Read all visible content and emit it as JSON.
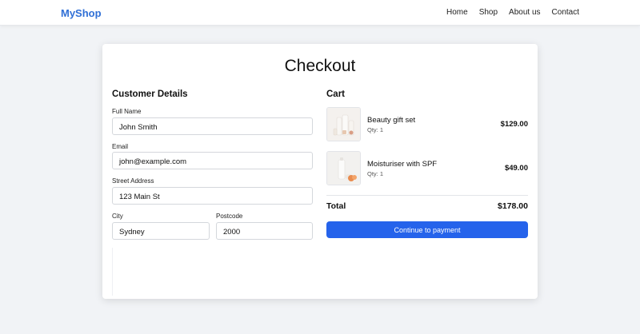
{
  "nav": {
    "brand": "MyShop",
    "links": [
      "Home",
      "Shop",
      "About us",
      "Contact"
    ],
    "brand_color": "#2f6fd6"
  },
  "checkout": {
    "title": "Checkout",
    "customer": {
      "heading": "Customer Details",
      "full_name_label": "Full Name",
      "full_name_value": "John Smith",
      "email_label": "Email",
      "email_value": "john@example.com",
      "street_label": "Street Address",
      "street_value": "123 Main St",
      "city_label": "City",
      "city_value": "Sydney",
      "postcode_label": "Postcode",
      "postcode_value": "2000"
    },
    "cart": {
      "heading": "Cart",
      "items": [
        {
          "name": "Beauty gift set",
          "qty": "Qty: 1",
          "price": "$129.00",
          "icon": "beauty-gift-set-thumbnail"
        },
        {
          "name": "Moisturiser with SPF",
          "qty": "Qty: 1",
          "price": "$49.00",
          "icon": "moisturiser-thumbnail"
        }
      ],
      "total_label": "Total",
      "total_value": "$178.00",
      "pay_button": "Continue to payment",
      "pay_button_color": "#2563eb"
    }
  }
}
